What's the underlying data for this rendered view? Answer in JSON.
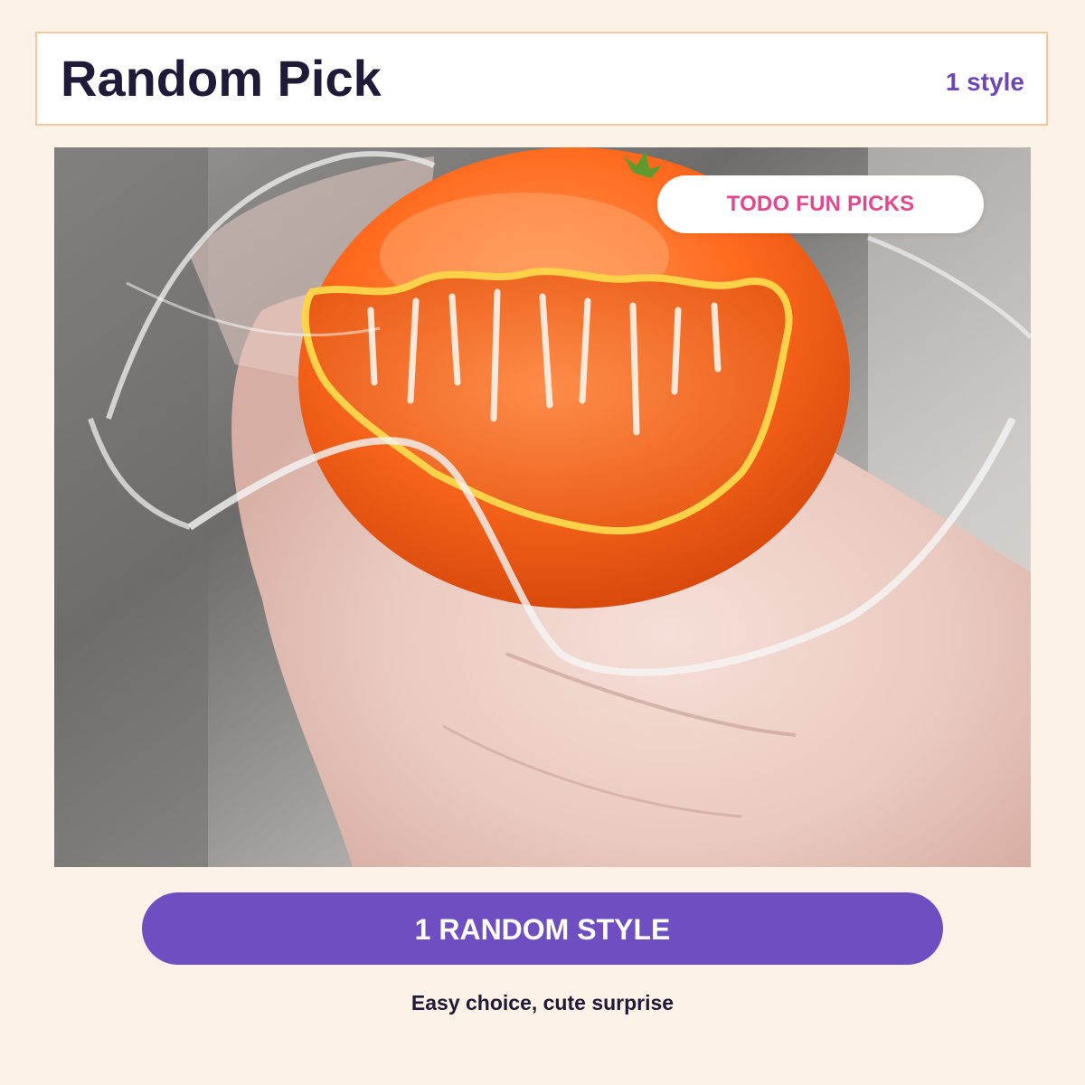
{
  "header": {
    "title": "Random Pick",
    "count_label": "1 style"
  },
  "photo": {
    "subject": "product-photo",
    "brand_badge": "TODO FUN PICKS"
  },
  "cta": {
    "label": "1 RANDOM STYLE"
  },
  "caption": "Easy choice, cute surprise",
  "colors": {
    "background": "#fdf2e7",
    "header_border": "#f6c79c",
    "title": "#1f1a38",
    "accent_purple": "#6e4ec0",
    "badge_pink": "#e0488f"
  }
}
